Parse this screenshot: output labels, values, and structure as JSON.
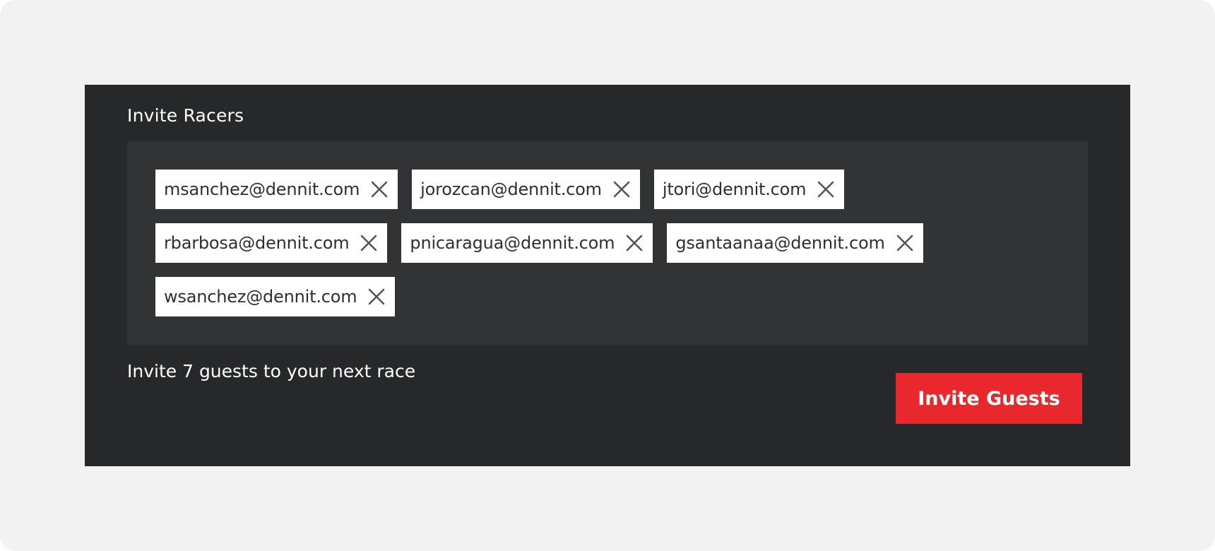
{
  "panel": {
    "title": "Invite Racers"
  },
  "chips": {
    "rows": [
      [
        {
          "email": "msanchez@dennit.com",
          "remove_icon": "close-icon"
        },
        {
          "email": "jorozcan@dennit.com",
          "remove_icon": "close-icon"
        },
        {
          "email": "jtori@dennit.com",
          "remove_icon": "close-icon"
        }
      ],
      [
        {
          "email": "rbarbosa@dennit.com",
          "remove_icon": "close-icon"
        },
        {
          "email": "pnicaragua@dennit.com",
          "remove_icon": "close-icon"
        },
        {
          "email": "gsantaanaa@dennit.com",
          "remove_icon": "close-icon"
        }
      ],
      [
        {
          "email": "wsanchez@dennit.com",
          "remove_icon": "close-icon"
        }
      ]
    ]
  },
  "summary": {
    "text": "Invite 7 guests to your next race"
  },
  "actions": {
    "invite_label": "Invite Guests"
  },
  "colors": {
    "page_background": "#f2f2f2",
    "panel_background": "#27282a",
    "chip_area_background": "#323335",
    "chip_background": "#ffffff",
    "chip_text": "#2e2f31",
    "close_icon": "#55565a",
    "accent": "#e8282d"
  }
}
